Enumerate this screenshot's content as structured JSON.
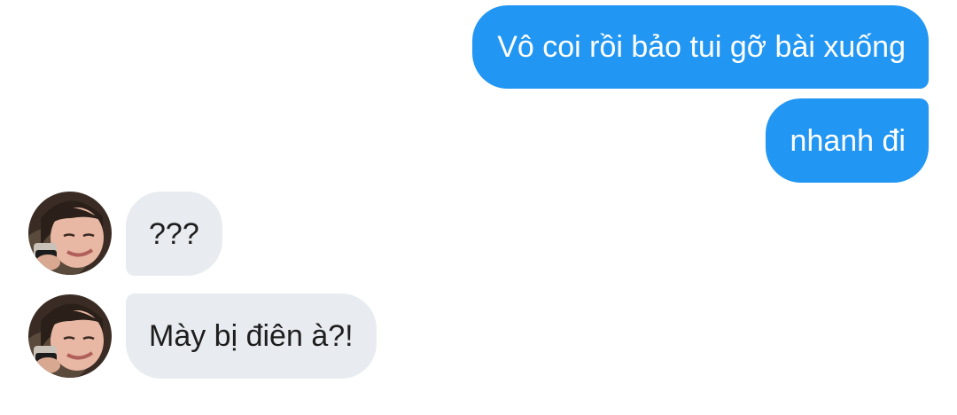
{
  "chat": {
    "messages": [
      {
        "direction": "outgoing",
        "text": "Vô coi rồi bảo tui gỡ bài xuống"
      },
      {
        "direction": "outgoing",
        "text": "nhanh đi"
      },
      {
        "direction": "incoming",
        "text": "???"
      },
      {
        "direction": "incoming",
        "text": "Mày bị điên à?!"
      }
    ]
  },
  "colors": {
    "outgoing_bubble": "#2196f3",
    "incoming_bubble": "#e8ebef",
    "outgoing_text": "#ffffff",
    "incoming_text": "#1e1e1e"
  }
}
